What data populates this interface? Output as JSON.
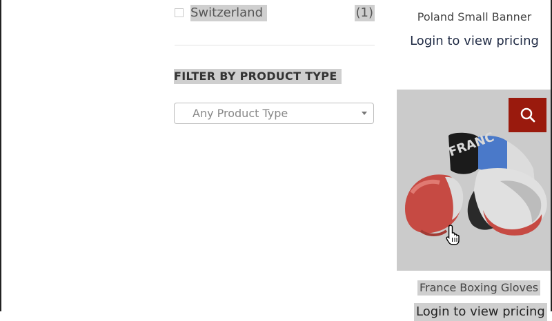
{
  "filters": {
    "country_item": {
      "label": "Switzerland",
      "count": "(1)"
    },
    "product_type": {
      "title": "FILTER BY PRODUCT TYPE",
      "select_value": "Any Product Type"
    }
  },
  "products": [
    {
      "title": "Poland Small Banner",
      "action": "Login to view pricing"
    },
    {
      "title": "France Boxing Gloves",
      "action": "Login to view pricing"
    }
  ],
  "colors": {
    "zoom_button": "#9a1a0d",
    "login_link": "#1f2a44",
    "highlight": "#cfcfcf"
  },
  "icons": {
    "zoom": "search-icon",
    "cursor": "hand-pointer-icon"
  }
}
